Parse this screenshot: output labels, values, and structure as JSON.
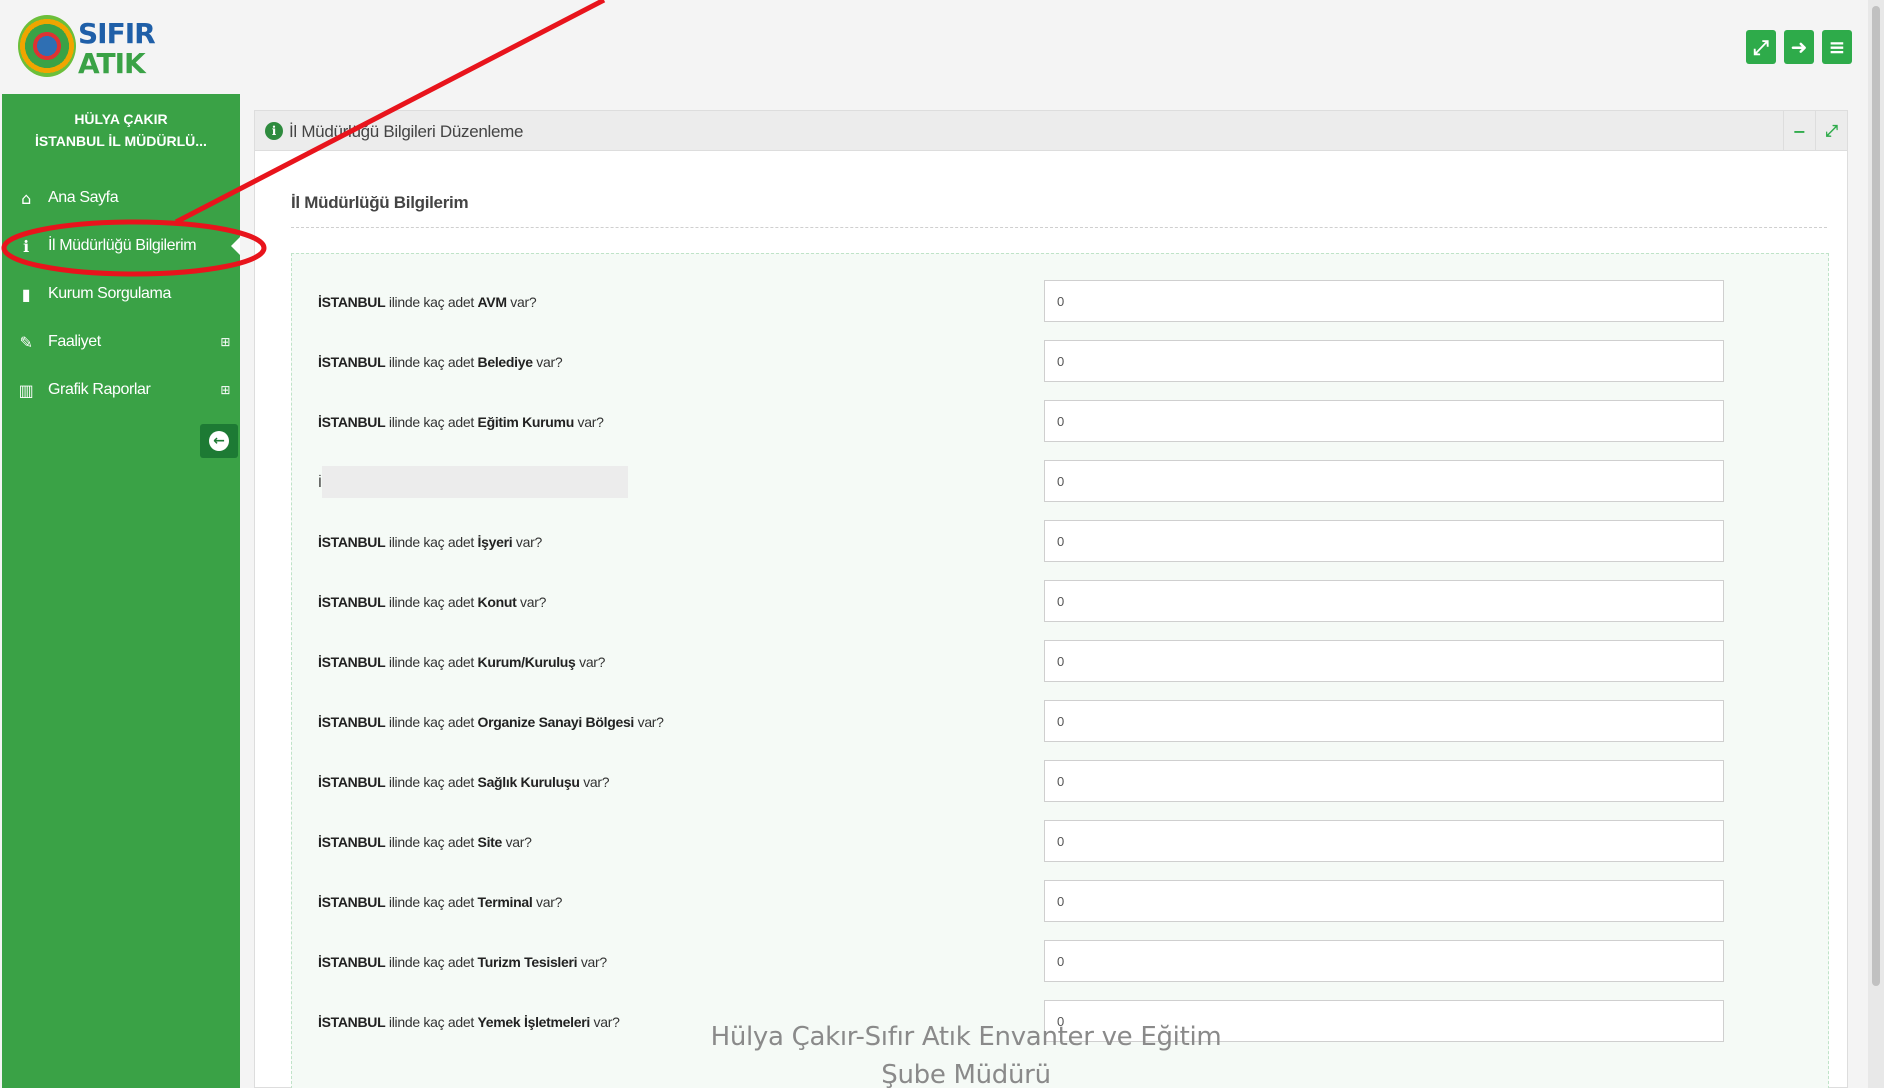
{
  "logo": {
    "word1": "SIFIR",
    "word2": "ATIK"
  },
  "topbar": {
    "buttons": [
      {
        "name": "fullscreen-button",
        "icon": "fullscreen-icon",
        "glyph": "⤢"
      },
      {
        "name": "logout-button",
        "icon": "sign-out-icon",
        "glyph": "➜"
      },
      {
        "name": "menu-button",
        "icon": "hamburger-icon",
        "glyph": "≡"
      }
    ]
  },
  "sidebar": {
    "user_name": "HÜLYA ÇAKIR",
    "user_org": "İSTANBUL İL MÜDÜRLÜ...",
    "items": [
      {
        "label": "Ana Sayfa",
        "icon": "home-icon",
        "glyph": "⌂",
        "expandable": false
      },
      {
        "label": "İl Müdürlüğü Bilgilerim",
        "icon": "info-icon",
        "glyph": "ℹ",
        "expandable": false,
        "active": true
      },
      {
        "label": "Kurum Sorgulama",
        "icon": "building-icon",
        "glyph": "▮",
        "expandable": false
      },
      {
        "label": "Faaliyet",
        "icon": "edit-icon",
        "glyph": "✎",
        "expandable": true
      },
      {
        "label": "Grafik Raporlar",
        "icon": "bar-chart-icon",
        "glyph": "▥",
        "expandable": true
      }
    ],
    "expand_glyph": "⊞",
    "collapse_glyph": "←"
  },
  "panel": {
    "title": "İl Müdürlüğü Bilgileri Düzenleme",
    "minimize_glyph": "−",
    "expand_glyph": "⤢",
    "section_title": "İl Müdürlüğü Bilgilerim",
    "questions": [
      {
        "city": "İSTANBUL",
        "mid": " ilinde kaç adet ",
        "item": "AVM",
        "tail": " var?",
        "value": "0"
      },
      {
        "city": "İSTANBUL",
        "mid": " ilinde kaç adet ",
        "item": "Belediye",
        "tail": " var?",
        "value": "0"
      },
      {
        "city": "İSTANBUL",
        "mid": " ilinde kaç adet ",
        "item": "Eğitim Kurumu",
        "tail": " var?",
        "value": "0"
      },
      {
        "city": "İ",
        "mid": "",
        "item": "",
        "tail": "",
        "value": "0",
        "redacted": true
      },
      {
        "city": "İSTANBUL",
        "mid": " ilinde kaç adet ",
        "item": "İşyeri",
        "tail": " var?",
        "value": "0"
      },
      {
        "city": "İSTANBUL",
        "mid": " ilinde kaç adet ",
        "item": "Konut",
        "tail": " var?",
        "value": "0"
      },
      {
        "city": "İSTANBUL",
        "mid": " ilinde kaç adet ",
        "item": "Kurum/Kuruluş",
        "tail": " var?",
        "value": "0"
      },
      {
        "city": "İSTANBUL",
        "mid": " ilinde kaç adet ",
        "item": "Organize Sanayi Bölgesi",
        "tail": " var?",
        "value": "0"
      },
      {
        "city": "İSTANBUL",
        "mid": " ilinde kaç adet ",
        "item": "Sağlık Kuruluşu",
        "tail": " var?",
        "value": "0"
      },
      {
        "city": "İSTANBUL",
        "mid": " ilinde kaç adet ",
        "item": "Site",
        "tail": " var?",
        "value": "0"
      },
      {
        "city": "İSTANBUL",
        "mid": " ilinde kaç adet ",
        "item": "Terminal",
        "tail": " var?",
        "value": "0"
      },
      {
        "city": "İSTANBUL",
        "mid": " ilinde kaç adet ",
        "item": "Turizm Tesisleri",
        "tail": " var?",
        "value": "0"
      },
      {
        "city": "İSTANBUL",
        "mid": " ilinde kaç adet ",
        "item": "Yemek İşletmeleri",
        "tail": " var?",
        "value": "0"
      }
    ]
  },
  "watermark": {
    "line1": "Hülya Çakır-Sıfır Atık Envanter ve Eğitim",
    "line2": "Şube Müdürü"
  },
  "colors": {
    "brand_green": "#3aa246",
    "button_green": "#2eab4a",
    "annotation_red": "#e8141c"
  }
}
